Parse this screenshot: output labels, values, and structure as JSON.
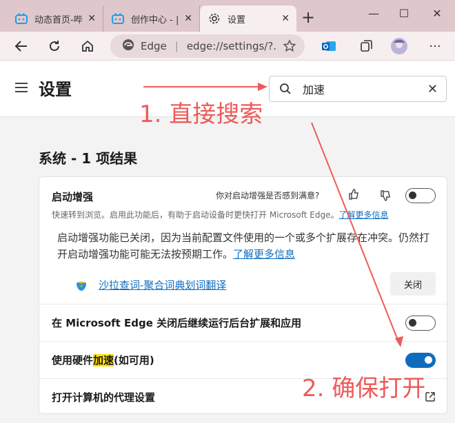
{
  "browser": {
    "tabs": [
      {
        "label": "动态首页-哔",
        "icon": "bilibili-icon",
        "active": false
      },
      {
        "label": "创作中心 - |",
        "icon": "bilibili-icon",
        "active": false
      },
      {
        "label": "设置",
        "icon": "gear-icon",
        "active": true
      }
    ],
    "address": {
      "site": "Edge",
      "url": "edge://settings/?..."
    }
  },
  "header": {
    "title": "设置",
    "search_value": "加速"
  },
  "results_title": "系统 - 1 项结果",
  "startup_boost": {
    "title": "启动增强",
    "feedback_question": "你对启动增强是否感到满意?",
    "toggle_on": false,
    "description": "快速转到浏览。启用此功能后，有助于启动设备时更快打开 Microsoft Edge。",
    "learn_more": "了解更多信息",
    "warning_line1": "启动增强功能已关闭，因为当前配置文件使用的一个或多个扩展存在冲突。仍然打",
    "warning_line2": "开启动增强功能可能无法按预期工作。",
    "warning_link": "了解更多信息",
    "extension_name": "沙拉查词-聚合词典划词翻译",
    "close_button": "关闭"
  },
  "background_row": {
    "label": "在 Microsoft Edge 关闭后继续运行后台扩展和应用",
    "toggle_on": false
  },
  "hardware_row": {
    "label_before": "使用硬件",
    "label_highlight": "加速",
    "label_after": "(如可用)",
    "toggle_on": true
  },
  "proxy_row": {
    "label": "打开计算机的代理设置"
  },
  "annotations": {
    "step1": "1. 直接搜索",
    "step2": "2. 确保打开",
    "color": "#ee5a5a"
  },
  "colors": {
    "accent": "#0f6cbd",
    "tabstrip": "#dfc8cc",
    "highlight": "#ffe100"
  }
}
